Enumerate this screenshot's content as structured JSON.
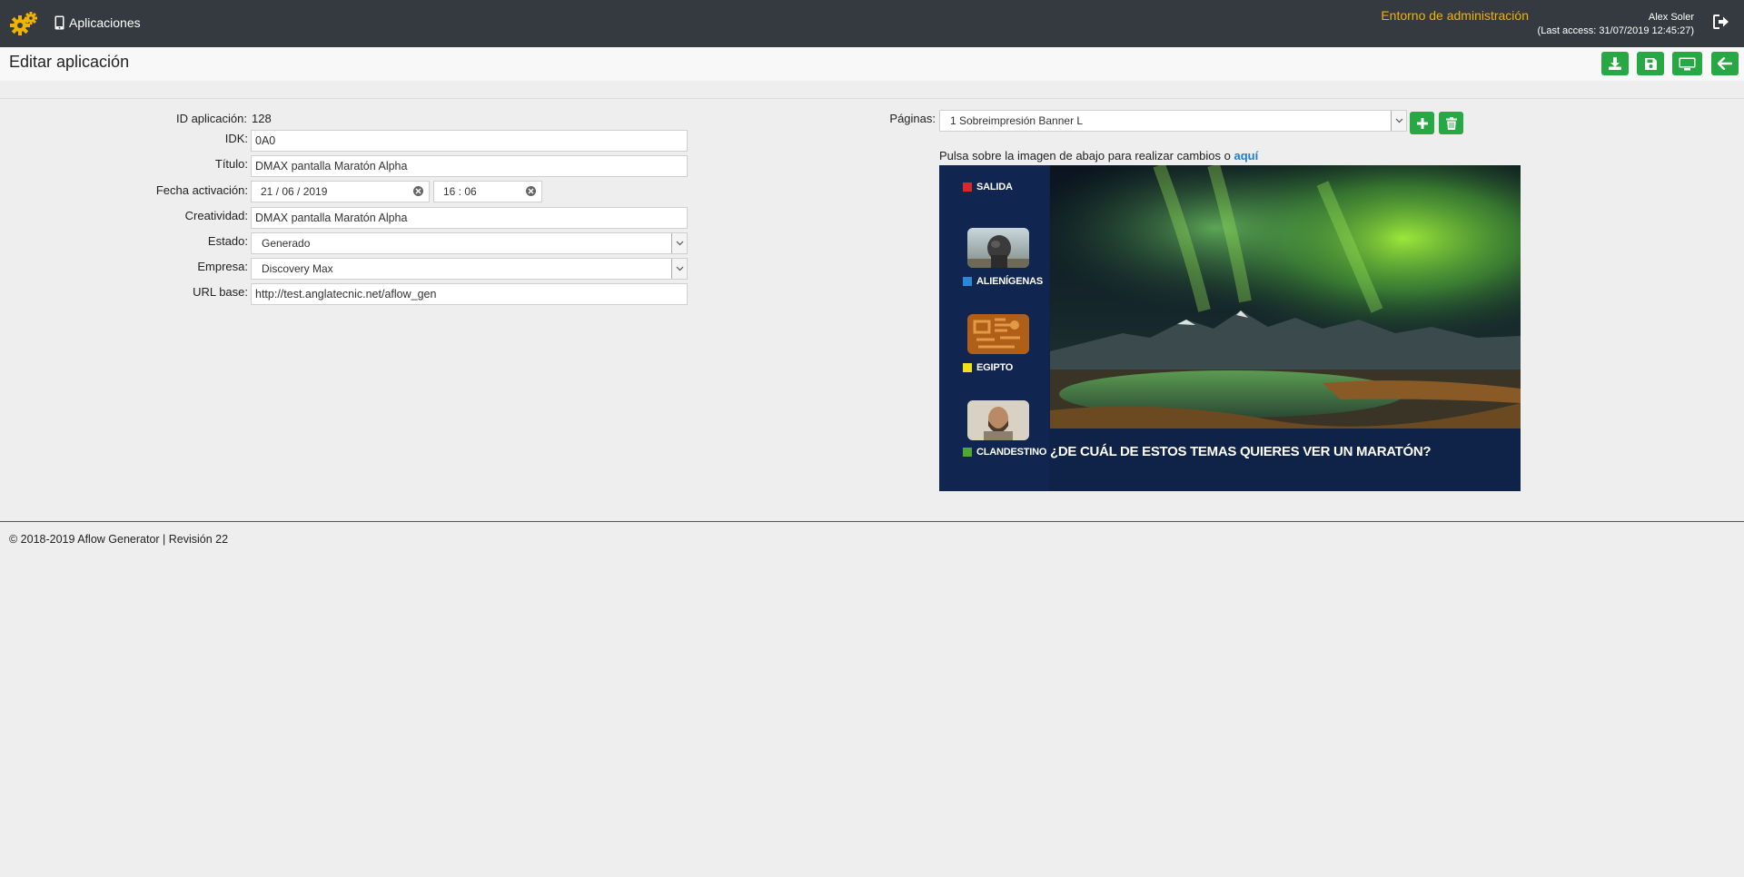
{
  "navbar": {
    "apps_label": "Aplicaciones",
    "env_label": "Entorno de administración",
    "user_name": "Alex Soler",
    "last_access": "(Last access: 31/07/2019 12:45:27)"
  },
  "header": {
    "title": "Editar aplicación"
  },
  "form": {
    "id_label": "ID aplicación:",
    "id_value": "128",
    "idk_label": "IDK:",
    "idk_value": "0A0",
    "titulo_label": "Título:",
    "titulo_value": "DMAX pantalla Maratón Alpha",
    "fecha_label": "Fecha activación:",
    "fecha_date": "21 / 06 / 2019",
    "fecha_time": "16 : 06",
    "creatividad_label": "Creatividad:",
    "creatividad_value": "DMAX pantalla Maratón Alpha",
    "estado_label": "Estado:",
    "estado_value": "Generado",
    "empresa_label": "Empresa:",
    "empresa_value": "Discovery Max",
    "url_label": "URL base:",
    "url_value": "http://test.anglatecnic.net/aflow_gen"
  },
  "pages": {
    "label": "Páginas:",
    "selected": "1 Sobreimpresión Banner L",
    "hint_text": "Pulsa sobre la imagen de abajo para realizar cambios o ",
    "hint_link": "aquí"
  },
  "banner": {
    "options": [
      {
        "label": "SALIDA",
        "color": "#d32a2a"
      },
      {
        "label": "ALIENÍGENAS",
        "color": "#2a88d6"
      },
      {
        "label": "EGIPTO",
        "color": "#f2e21a"
      },
      {
        "label": "CLANDESTINO",
        "color": "#4caa32"
      }
    ],
    "question": "¿DE CUÁL DE ESTOS TEMAS QUIERES VER UN MARATÓN?"
  },
  "footer": {
    "text": "© 2018-2019 Aflow Generator | Revisión 22"
  },
  "colors": {
    "navbar": "#343a40",
    "accent": "#f0b400",
    "button": "#28a745",
    "link": "#1e7fd0"
  }
}
